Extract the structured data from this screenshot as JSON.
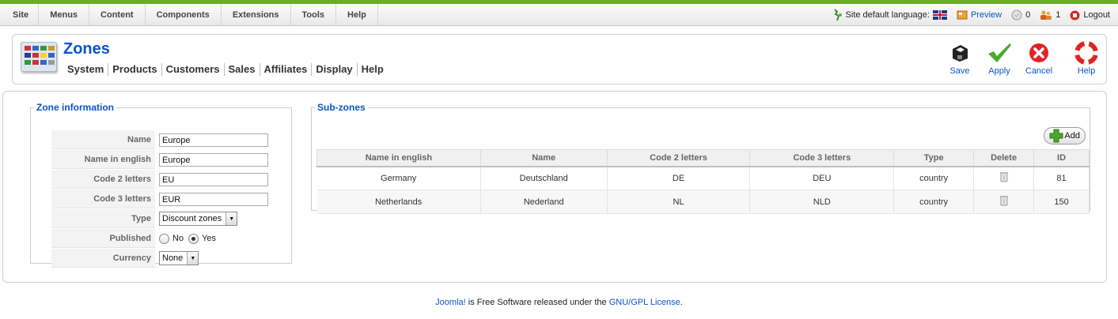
{
  "topmenu": {
    "items": [
      "Site",
      "Menus",
      "Content",
      "Components",
      "Extensions",
      "Tools",
      "Help"
    ]
  },
  "status": {
    "language_label": "Site default language:",
    "preview": "Preview",
    "messages_count": "0",
    "users_count": "1",
    "logout": "Logout"
  },
  "header": {
    "title": "Zones",
    "subnav": [
      "System",
      "Products",
      "Customers",
      "Sales",
      "Affiliates",
      "Display",
      "Help"
    ]
  },
  "toolbar": {
    "save": "Save",
    "apply": "Apply",
    "cancel": "Cancel",
    "help": "Help"
  },
  "zone_info": {
    "legend": "Zone information",
    "name_label": "Name",
    "name_value": "Europe",
    "name_en_label": "Name in english",
    "name_en_value": "Europe",
    "code2_label": "Code 2 letters",
    "code2_value": "EU",
    "code3_label": "Code 3 letters",
    "code3_value": "EUR",
    "type_label": "Type",
    "type_value": "Discount zones",
    "published_label": "Published",
    "published_no": "No",
    "published_yes": "Yes",
    "currency_label": "Currency",
    "currency_value": "None"
  },
  "subzones": {
    "legend": "Sub-zones",
    "add_label": "Add",
    "columns": [
      "Name in english",
      "Name",
      "Code 2 letters",
      "Code 3 letters",
      "Type",
      "Delete",
      "ID"
    ],
    "rows": [
      {
        "name_en": "Germany",
        "name": "Deutschland",
        "code2": "DE",
        "code3": "DEU",
        "type": "country",
        "id": "81"
      },
      {
        "name_en": "Netherlands",
        "name": "Nederland",
        "code2": "NL",
        "code3": "NLD",
        "type": "country",
        "id": "150"
      }
    ]
  },
  "footer": {
    "brand": "Joomla!",
    "text": " is Free Software released under the ",
    "license": "GNU/GPL License",
    "end": "."
  }
}
